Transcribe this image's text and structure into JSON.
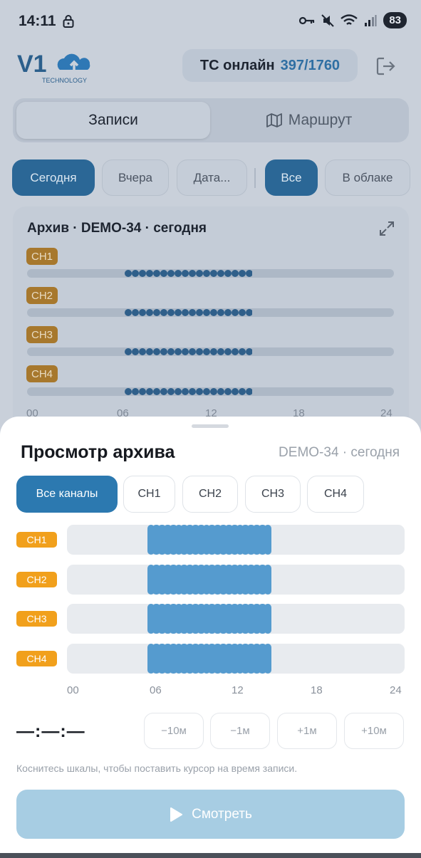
{
  "status_bar": {
    "time": "14:11",
    "battery": "83"
  },
  "header": {
    "logo_text": "V1",
    "logo_sub": "TECHNOLOGY",
    "online_label": "ТС онлайн",
    "online_value": "397/1760"
  },
  "main_tabs": [
    {
      "label": "Записи",
      "active": true
    },
    {
      "label": "Маршрут",
      "active": false,
      "icon": "map-icon"
    }
  ],
  "filters": {
    "date": [
      {
        "label": "Сегодня",
        "active": true
      },
      {
        "label": "Вчера",
        "active": false
      },
      {
        "label": "Дата...",
        "active": false
      }
    ],
    "source": [
      {
        "label": "Все",
        "active": true
      },
      {
        "label": "В облаке",
        "active": false
      }
    ]
  },
  "archive": {
    "title": "Архив · DEMO-34 · сегодня",
    "channels": [
      "CH1",
      "CH2",
      "CH3",
      "CH4"
    ],
    "axis": [
      "00",
      "06",
      "12",
      "18",
      "24"
    ]
  },
  "sheet": {
    "title": "Просмотр архива",
    "subtitle": "DEMO-34 · сегодня",
    "channel_tabs": [
      {
        "label": "Все каналы",
        "active": true
      },
      {
        "label": "CH1",
        "active": false
      },
      {
        "label": "CH2",
        "active": false
      },
      {
        "label": "CH3",
        "active": false
      },
      {
        "label": "CH4",
        "active": false
      }
    ],
    "timeline": {
      "range_hours": [
        0,
        24
      ],
      "recorded_from_hour": 5.7,
      "recorded_to_hour": 14.4,
      "channels": [
        "CH1",
        "CH2",
        "CH3",
        "CH4"
      ],
      "axis_labels": [
        "00",
        "06",
        "12",
        "18",
        "24"
      ]
    },
    "time_readout": "—:—:—",
    "steps": [
      "−10м",
      "−1м",
      "+1м",
      "+10м"
    ],
    "hint": "Коснитесь шкалы, чтобы поставить курсор на время записи.",
    "watch_label": "Смотреть"
  },
  "colors": {
    "accent": "#2c79b0",
    "channel_badge": "#f1a01c",
    "recording_fill": "#559bcf",
    "watch_disabled": "#a7cde3"
  }
}
